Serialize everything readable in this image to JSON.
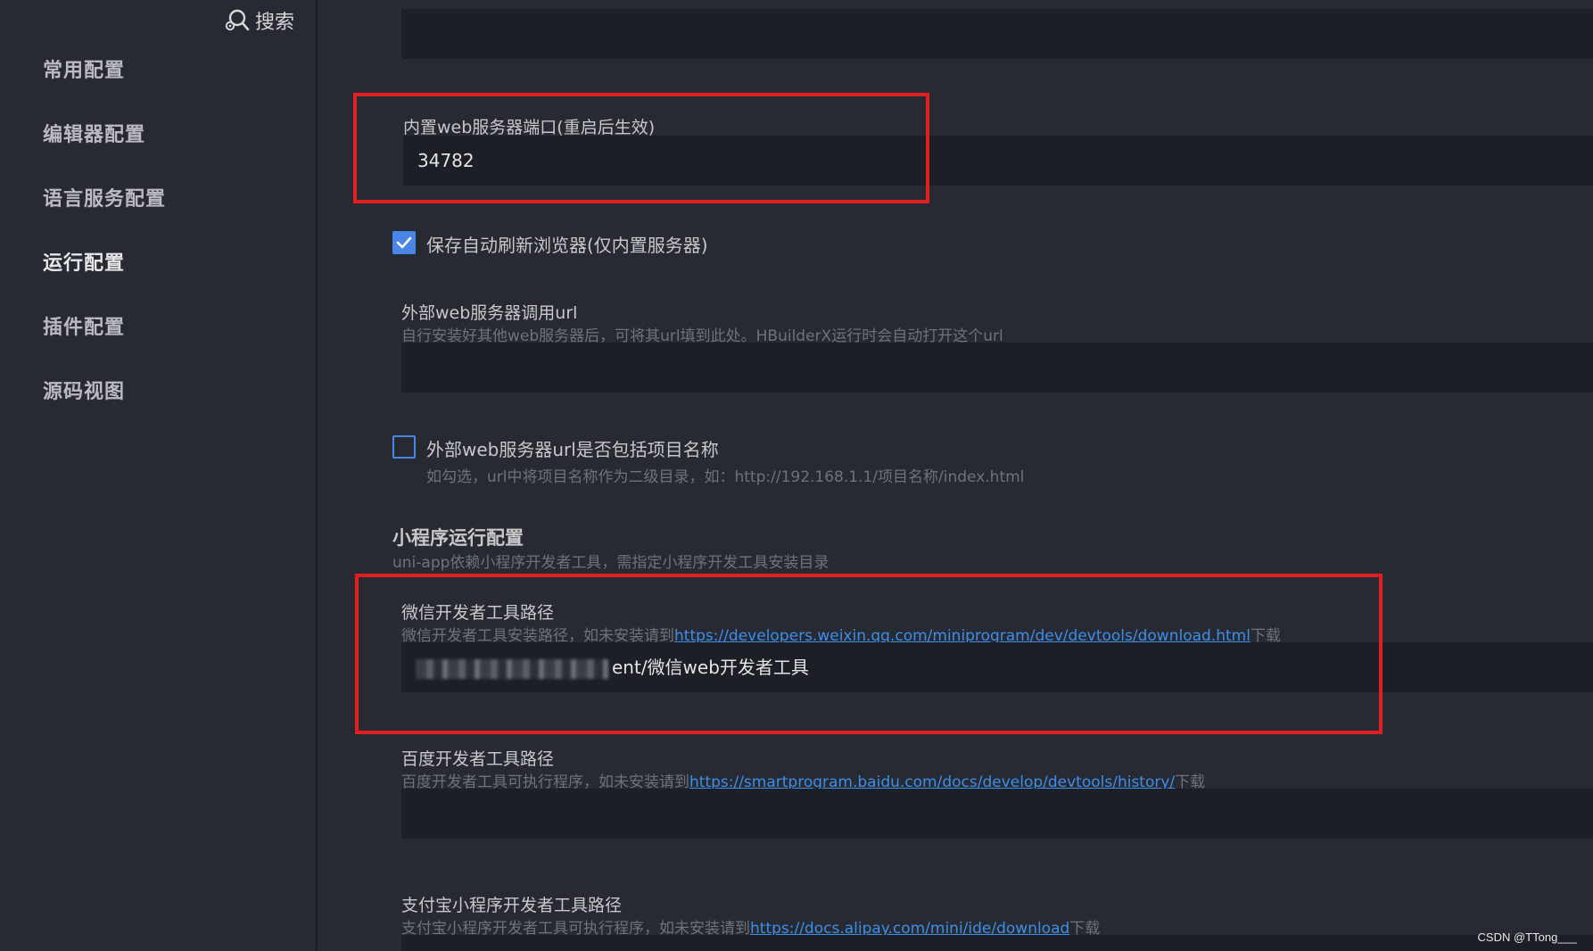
{
  "sidebar": {
    "search_label": "搜索",
    "items": [
      {
        "label": "常用配置"
      },
      {
        "label": "编辑器配置"
      },
      {
        "label": "语言服务配置"
      },
      {
        "label": "运行配置",
        "active": true
      },
      {
        "label": "插件配置"
      },
      {
        "label": "源码视图"
      }
    ]
  },
  "main": {
    "web_port": {
      "label": "内置web服务器端口(重启后生效)",
      "value": "34782"
    },
    "auto_refresh": {
      "label": "保存自动刷新浏览器(仅内置服务器)",
      "checked": true
    },
    "external_url": {
      "label": "外部web服务器调用url",
      "hint": "自行安装好其他web服务器后，可将其url填到此处。HBuilderX运行时会自动打开这个url",
      "value": ""
    },
    "include_project_name": {
      "label": "外部web服务器url是否包括项目名称",
      "hint": "如勾选，url中将项目名称作为二级目录，如：http://192.168.1.1/项目名称/index.html",
      "checked": false
    },
    "mini_program": {
      "title": "小程序运行配置",
      "hint": "uni-app依赖小程序开发者工具，需指定小程序开发工具安装目录"
    },
    "wechat": {
      "label": "微信开发者工具路径",
      "hint_prefix": "微信开发者工具安装路径，如未安装请到",
      "link": "https://developers.weixin.qq.com/miniprogram/dev/devtools/download.html",
      "hint_suffix": "下载",
      "value_visible": "ent/微信web开发者工具"
    },
    "baidu": {
      "label": "百度开发者工具路径",
      "hint_prefix": "百度开发者工具可执行程序，如未安装请到",
      "link": "https://smartprogram.baidu.com/docs/develop/devtools/history/",
      "hint_suffix": "下载",
      "value": ""
    },
    "alipay": {
      "label": "支付宝小程序开发者工具路径",
      "hint_prefix": "支付宝小程序开发者工具可执行程序，如未安装请到",
      "link": "https://docs.alipay.com/mini/ide/download",
      "hint_suffix": "下载"
    }
  },
  "watermark": "CSDN @TTong___",
  "colors": {
    "background": "#272a33",
    "input": "#1d1f26",
    "accent": "#4a86e8",
    "link": "#3d8ee6",
    "highlight": "#e02020"
  }
}
